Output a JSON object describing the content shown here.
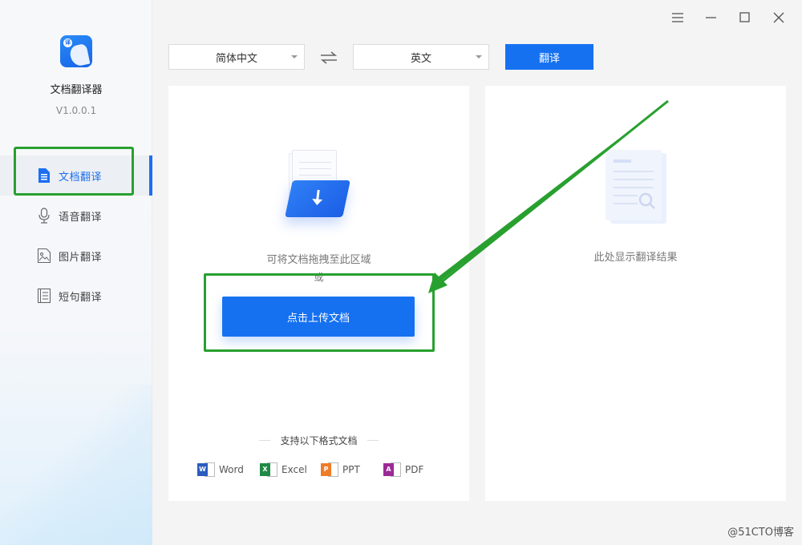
{
  "app": {
    "name": "文档翻译器",
    "version": "V1.0.0.1",
    "logo_badge": "译"
  },
  "sidebar": {
    "items": [
      {
        "label": "文档翻译",
        "icon": "document-icon",
        "active": true
      },
      {
        "label": "语音翻译",
        "icon": "microphone-icon",
        "active": false
      },
      {
        "label": "图片翻译",
        "icon": "image-icon",
        "active": false
      },
      {
        "label": "短句翻译",
        "icon": "text-lines-icon",
        "active": false
      }
    ]
  },
  "window_controls": [
    "menu-icon",
    "minimize-icon",
    "maximize-icon",
    "close-icon"
  ],
  "toolbar": {
    "source_language": "简体中文",
    "target_language": "英文",
    "swap_icon": "swap-arrows-icon",
    "translate_label": "翻译"
  },
  "upload_panel": {
    "drop_hint": "可将文档拖拽至此区域",
    "or_text": "或",
    "upload_label": "点击上传文档",
    "formats_title": "支持以下格式文档",
    "formats": [
      {
        "label": "Word",
        "badge": "W",
        "color": "#2b5cbf"
      },
      {
        "label": "Excel",
        "badge": "X",
        "color": "#1f8a45"
      },
      {
        "label": "PPT",
        "badge": "P",
        "color": "#ee7b2a"
      },
      {
        "label": "PDF",
        "badge": "A",
        "color": "#9b2a96"
      }
    ]
  },
  "result_panel": {
    "placeholder": "此处显示翻译结果"
  },
  "colors": {
    "accent": "#1671f1",
    "annotation": "#28a02f"
  },
  "watermark": "@51CTO博客"
}
